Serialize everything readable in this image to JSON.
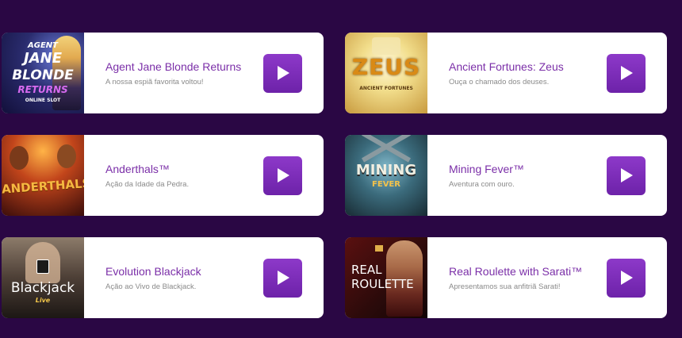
{
  "games": [
    {
      "title": "Agent Jane Blonde Returns",
      "description": "A nossa espiã favorita voltou!",
      "thumb": {
        "lines": [
          "AGENT",
          "JANE",
          "BLONDE",
          "RETURNS",
          "ONLINE SLOT"
        ]
      }
    },
    {
      "title": "Ancient Fortunes: Zeus",
      "description": "Ouça o chamado dos deuses.",
      "thumb": {
        "lines": [
          "ZEUS",
          "ANCIENT FORTUNES"
        ]
      }
    },
    {
      "title": "Anderthals™",
      "description": "Ação da Idade da Pedra.",
      "thumb": {
        "lines": [
          "ANDERTHALS"
        ]
      }
    },
    {
      "title": "Mining Fever™",
      "description": "Aventura com ouro.",
      "thumb": {
        "lines": [
          "MINING",
          "FEVER"
        ]
      }
    },
    {
      "title": "Evolution Blackjack",
      "description": "Ação ao Vivo de Blackjack.",
      "thumb": {
        "lines": [
          "Blackjack",
          "Live"
        ]
      }
    },
    {
      "title": "Real Roulette with Sarati™",
      "description": "Apresentamos sua anfitriã Sarati!",
      "thumb": {
        "lines": [
          "REAL",
          "ROULETTE"
        ]
      }
    }
  ],
  "colors": {
    "background": "#2a0744",
    "title": "#7b2fa8",
    "play_button": "#7d2dbb"
  },
  "icons": {
    "play": "play-icon"
  }
}
